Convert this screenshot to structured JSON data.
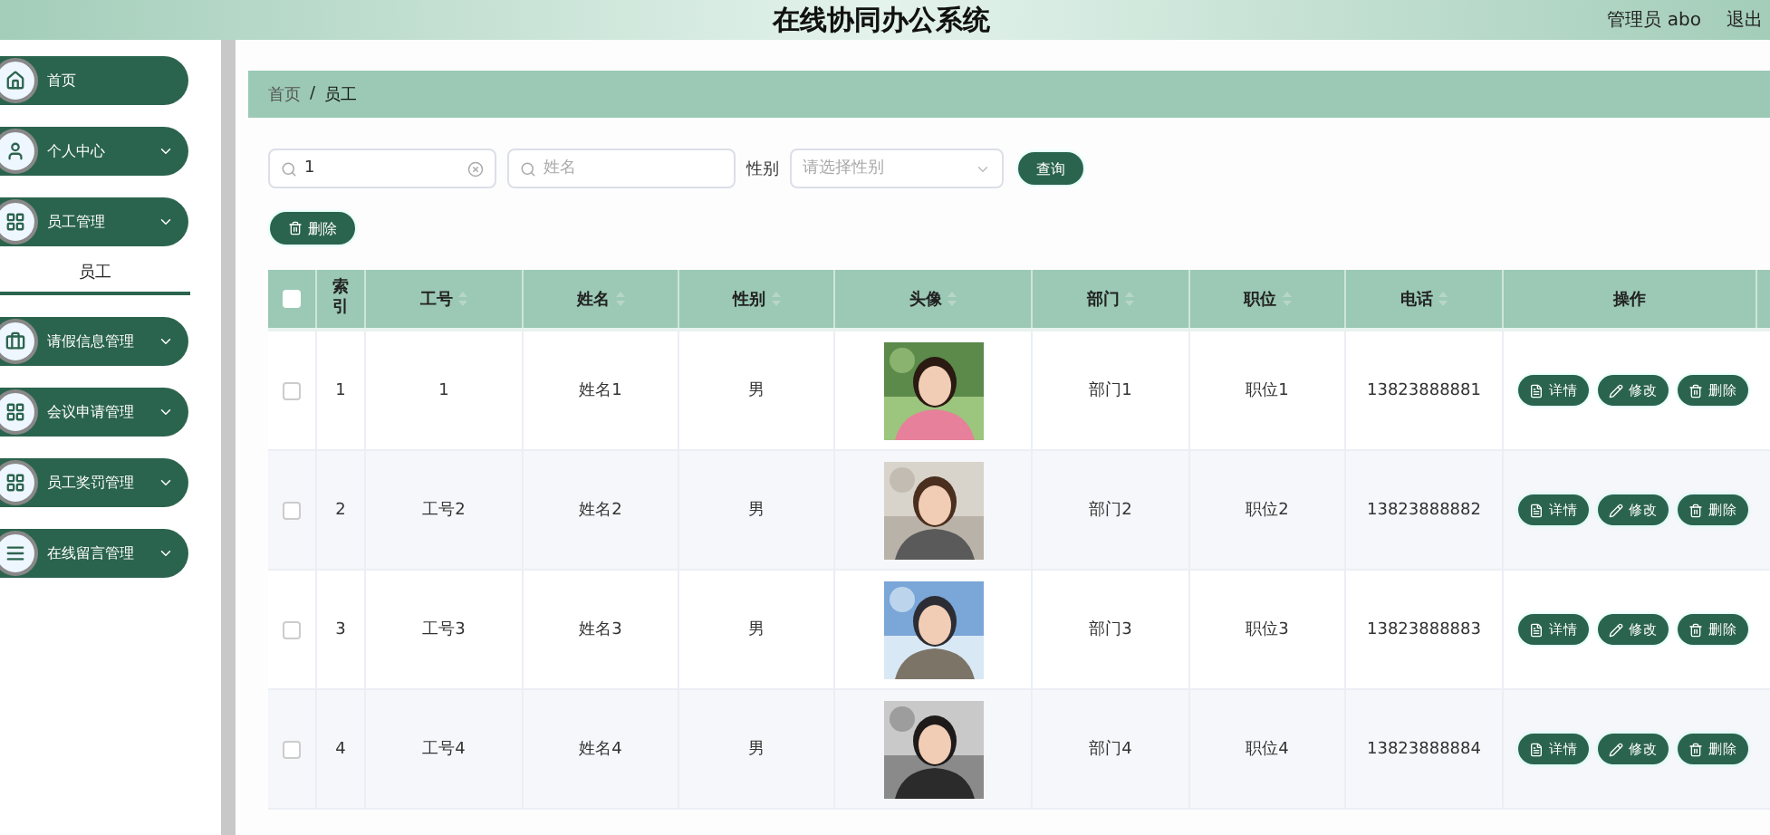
{
  "header": {
    "title": "在线协同办公系统",
    "user": "管理员 abo",
    "logout": "退出"
  },
  "sidebar": {
    "items": [
      {
        "label": "首页",
        "kind": "home",
        "expandable": false
      },
      {
        "label": "个人中心",
        "kind": "user",
        "expandable": true
      },
      {
        "label": "员工管理",
        "kind": "grid",
        "expandable": true,
        "children": [
          {
            "label": "员工",
            "selected": true
          }
        ]
      },
      {
        "label": "请假信息管理",
        "kind": "briefcase",
        "expandable": true
      },
      {
        "label": "会议申请管理",
        "kind": "grid",
        "expandable": true
      },
      {
        "label": "员工奖罚管理",
        "kind": "grid",
        "expandable": true
      },
      {
        "label": "在线留言管理",
        "kind": "list",
        "expandable": true
      }
    ]
  },
  "breadcrumb": {
    "items": [
      "首页",
      "员工"
    ],
    "separator": "/"
  },
  "filters": {
    "employee_no": {
      "value": "1"
    },
    "name": {
      "placeholder": "姓名"
    },
    "gender": {
      "label": "性别",
      "placeholder": "请选择性别"
    },
    "search_button": "查询"
  },
  "delete_button": "删除",
  "table": {
    "columns": [
      {
        "label": "索引",
        "sortable": false
      },
      {
        "label": "工号",
        "sortable": true
      },
      {
        "label": "姓名",
        "sortable": true
      },
      {
        "label": "性别",
        "sortable": true
      },
      {
        "label": "头像",
        "sortable": true
      },
      {
        "label": "部门",
        "sortable": true
      },
      {
        "label": "职位",
        "sortable": true
      },
      {
        "label": "电话",
        "sortable": true
      },
      {
        "label": "操作",
        "sortable": false
      }
    ],
    "all_checked": false,
    "rows": [
      {
        "checked": false,
        "index": "1",
        "employee_no": "1",
        "name": "姓名1",
        "gender": "男",
        "avatar": {
          "kind": "picture"
        },
        "department": "部门1",
        "position": "职位1",
        "phone": "13823888881",
        "actions": [
          "详情",
          "修改",
          "删除"
        ]
      },
      {
        "checked": false,
        "index": "2",
        "employee_no": "工号2",
        "name": "姓名2",
        "gender": "男",
        "avatar": {
          "kind": "picture"
        },
        "department": "部门2",
        "position": "职位2",
        "phone": "13823888882",
        "actions": [
          "详情",
          "修改",
          "删除"
        ]
      },
      {
        "checked": false,
        "index": "3",
        "employee_no": "工号3",
        "name": "姓名3",
        "gender": "男",
        "avatar": {
          "kind": "picture"
        },
        "department": "部门3",
        "position": "职位3",
        "phone": "13823888883",
        "actions": [
          "详情",
          "修改",
          "删除"
        ]
      },
      {
        "checked": false,
        "index": "4",
        "employee_no": "工号4",
        "name": "姓名4",
        "gender": "男",
        "avatar": {
          "kind": "picture"
        },
        "department": "部门4",
        "position": "职位4",
        "phone": "13823888884",
        "actions": [
          "详情",
          "修改",
          "删除"
        ]
      }
    ]
  }
}
